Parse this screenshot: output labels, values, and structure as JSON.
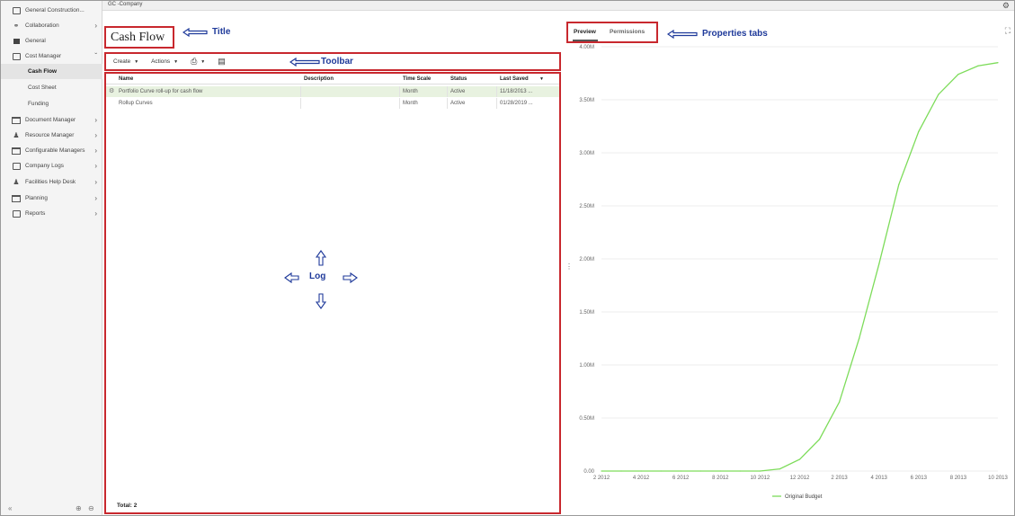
{
  "breadcrumb": "GC -Company",
  "sidebar": {
    "items": [
      {
        "label": "General Construction...",
        "icon": "building-icon",
        "has_chevron": false
      },
      {
        "label": "Collaboration",
        "icon": "handshake-icon",
        "has_chevron": true
      },
      {
        "label": "General",
        "icon": "general-icon",
        "has_chevron": false
      },
      {
        "label": "Cost Manager",
        "icon": "dollar-icon",
        "has_chevron": true,
        "expanded": true
      },
      {
        "label": "Cash Flow",
        "sub": true,
        "selected": true
      },
      {
        "label": "Cost Sheet",
        "sub": true
      },
      {
        "label": "Funding",
        "sub": true
      },
      {
        "label": "Document Manager",
        "icon": "folder-icon",
        "has_chevron": true
      },
      {
        "label": "Resource Manager",
        "icon": "people-icon",
        "has_chevron": true
      },
      {
        "label": "Configurable Managers",
        "icon": "folder-icon",
        "has_chevron": true
      },
      {
        "label": "Company Logs",
        "icon": "log-icon",
        "has_chevron": true
      },
      {
        "label": "Facilities Help Desk",
        "icon": "person-icon",
        "has_chevron": true
      },
      {
        "label": "Planning",
        "icon": "folder-icon",
        "has_chevron": true
      },
      {
        "label": "Reports",
        "icon": "report-icon",
        "has_chevron": true
      }
    ]
  },
  "page_title": "Cash Flow",
  "toolbar": {
    "create_label": "Create",
    "actions_label": "Actions"
  },
  "log": {
    "columns": [
      "Name",
      "Description",
      "Time Scale",
      "Status",
      "Last Saved"
    ],
    "rows": [
      {
        "name": "Portfolio Curve roll-up for cash flow",
        "description": "",
        "time_scale": "Month",
        "status": "Active",
        "last_saved": "11/18/2013 ..."
      },
      {
        "name": "Rollup Curves",
        "description": "",
        "time_scale": "Month",
        "status": "Active",
        "last_saved": "01/28/2019 ..."
      }
    ],
    "total_label": "Total: 2"
  },
  "tabs": {
    "preview_label": "Preview",
    "permissions_label": "Permissions"
  },
  "annotations": {
    "title": "Title",
    "toolbar": "Toolbar",
    "log": "Log",
    "properties_tabs": "Properties tabs"
  },
  "colors": {
    "annotation_box": "#c8282e",
    "annotation_text": "#1f3a9a",
    "selected_row": "#e8f2e0",
    "series_line": "#7ddc5a"
  },
  "chart_data": {
    "type": "line",
    "title": "",
    "xlabel": "",
    "ylabel": "",
    "x_tick_labels": [
      "2 2012",
      "4 2012",
      "6 2012",
      "8 2012",
      "10 2012",
      "12 2012",
      "2 2013",
      "4 2013",
      "6 2013",
      "8 2013",
      "10 2013"
    ],
    "y_tick_labels": [
      "0.00",
      "0.50M",
      "1.00M",
      "1.50M",
      "2.00M",
      "2.50M",
      "3.00M",
      "3.50M",
      "4.00M"
    ],
    "ylim": [
      0,
      4000000
    ],
    "grid": "horizontal",
    "legend_position": "bottom",
    "series": [
      {
        "name": "Original Budget",
        "x": [
          "2 2012",
          "3 2012",
          "4 2012",
          "5 2012",
          "6 2012",
          "7 2012",
          "8 2012",
          "9 2012",
          "10 2012",
          "11 2012",
          "12 2012",
          "1 2013",
          "2 2013",
          "3 2013",
          "4 2013",
          "5 2013",
          "6 2013",
          "7 2013",
          "8 2013",
          "9 2013",
          "10 2013"
        ],
        "values": [
          0,
          0,
          0,
          0,
          0,
          0,
          0,
          0,
          0,
          20000,
          110000,
          300000,
          650000,
          1250000,
          1950000,
          2700000,
          3200000,
          3550000,
          3740000,
          3820000,
          3850000
        ]
      }
    ]
  }
}
